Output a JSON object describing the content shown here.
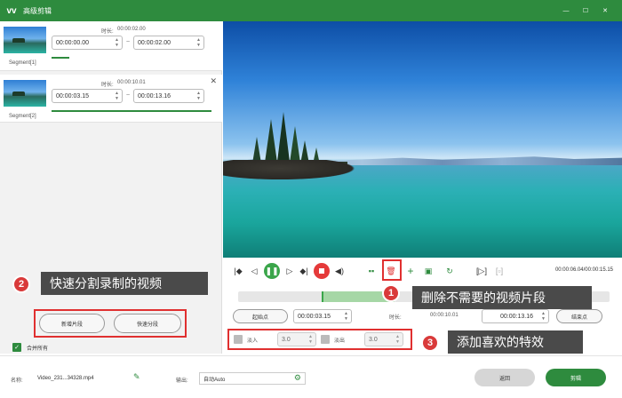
{
  "window": {
    "title": "高级剪辑",
    "logo": "vv",
    "controls": {
      "minimize": "—",
      "maximize": "☐",
      "close": "✕"
    }
  },
  "segments": [
    {
      "label": "Segment[1]",
      "duration_label": "时长:",
      "duration": "00:00:02.00",
      "start": "00:00:00.00",
      "end": "00:00:02.00"
    },
    {
      "label": "Segment[2]",
      "duration_label": "时长:",
      "duration": "00:00:10.01",
      "start": "00:00:03.15",
      "end": "00:00:13.16"
    }
  ],
  "left_buttons": {
    "new_segment": "新增片段",
    "quick_split": "快速分段"
  },
  "merge_all": {
    "label": "合并所有",
    "checked": true
  },
  "annotations": {
    "a1": {
      "num": "1",
      "text": "删除不需要的视频片段"
    },
    "a2": {
      "num": "2",
      "text": "快速分割录制的视频"
    },
    "a3": {
      "num": "3",
      "text": "添加喜欢的特效"
    }
  },
  "player": {
    "time_display": "00:00:06.04/00:00:15.15"
  },
  "trim": {
    "start_button": "起始点",
    "start_time": "00:00:03.15",
    "duration_label": "时长:",
    "duration": "00:00:10.01",
    "end_time": "00:00:13.16",
    "end_button": "结束点"
  },
  "fade": {
    "fade_in_label": "淡入",
    "fade_in_value": "3.0",
    "fade_out_label": "淡出",
    "fade_out_value": "3.0"
  },
  "bottom": {
    "name_label": "名称:",
    "file_name": "Video_231...34328.mp4",
    "output_label": "输出:",
    "output_value": "自动Auto",
    "back_button": "返回",
    "edit_button": "剪辑"
  },
  "colors": {
    "brand": "#2e8b3e",
    "accent_red": "#e03030",
    "annotation_bg": "#4a4a4a"
  }
}
